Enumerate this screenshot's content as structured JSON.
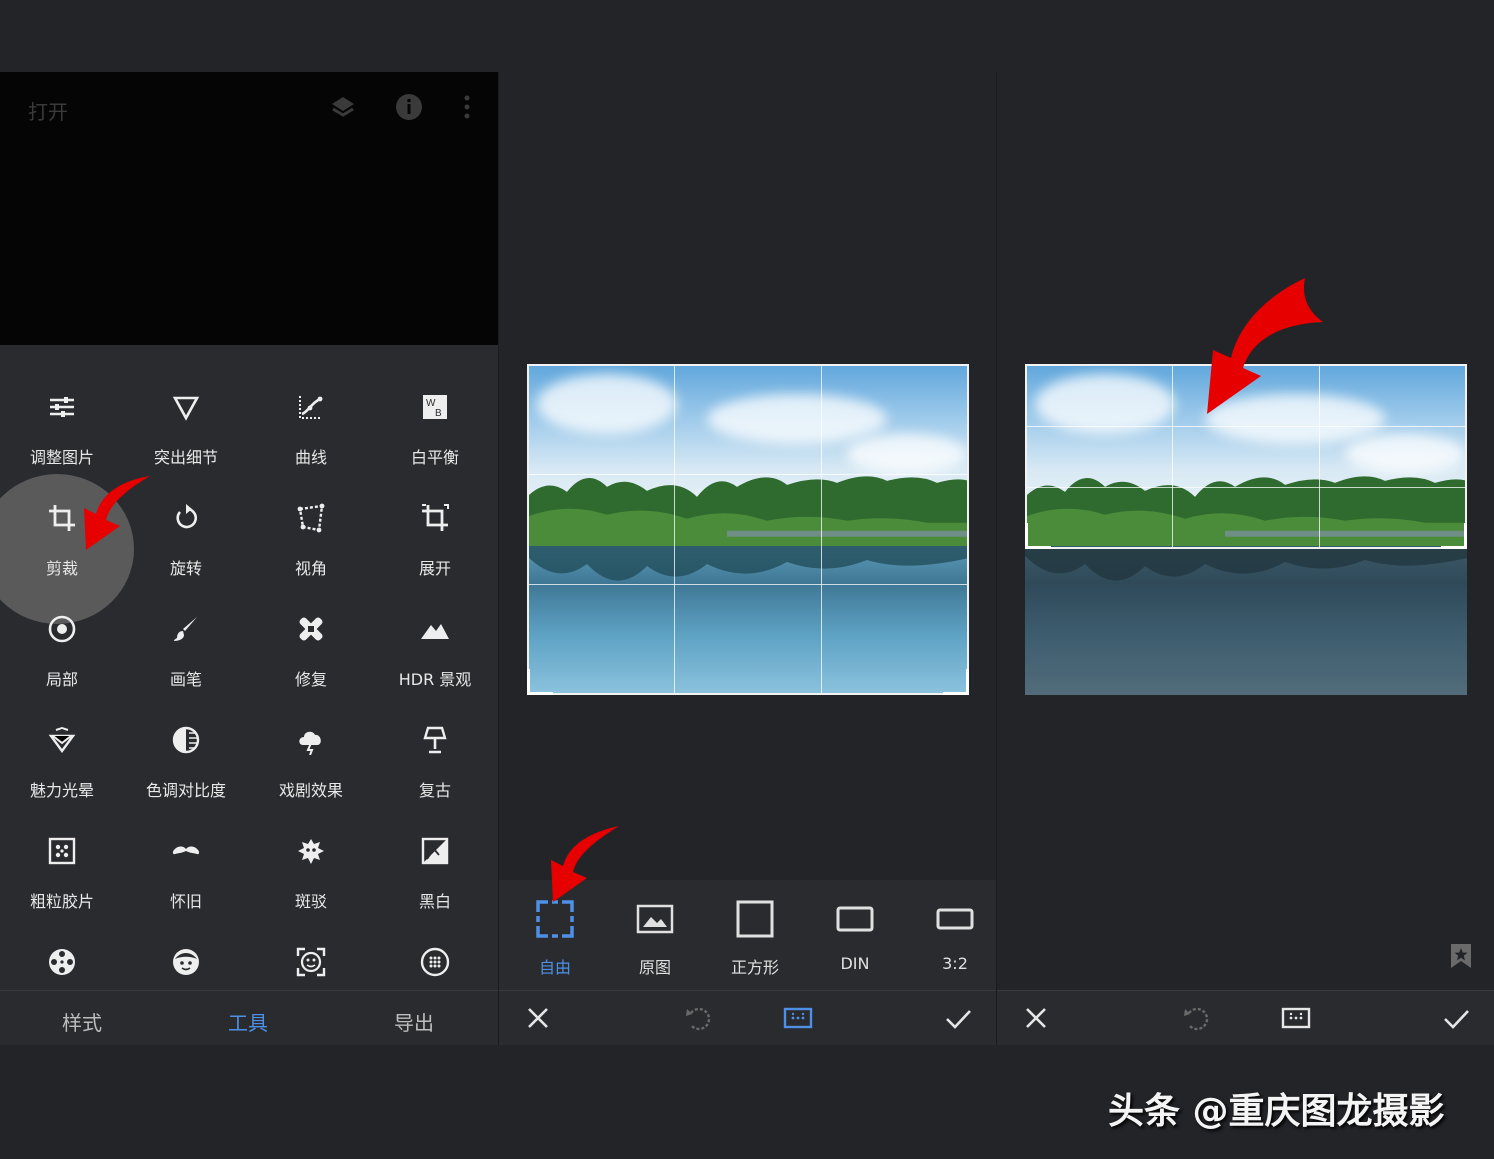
{
  "panel_open": {
    "title": "打开",
    "top_icons": [
      "layers-icon",
      "info-icon",
      "more-vert-icon"
    ],
    "tools": [
      {
        "label": "调整图片",
        "icon": "tune-icon"
      },
      {
        "label": "突出细节",
        "icon": "triangle-down-icon"
      },
      {
        "label": "曲线",
        "icon": "curves-icon"
      },
      {
        "label": "白平衡",
        "icon": "white-balance-icon"
      },
      {
        "label": "剪裁",
        "icon": "crop-icon"
      },
      {
        "label": "旋转",
        "icon": "rotate-icon"
      },
      {
        "label": "视角",
        "icon": "perspective-icon"
      },
      {
        "label": "展开",
        "icon": "expand-crop-icon"
      },
      {
        "label": "局部",
        "icon": "target-icon"
      },
      {
        "label": "画笔",
        "icon": "brush-icon"
      },
      {
        "label": "修复",
        "icon": "bandage-icon"
      },
      {
        "label": "HDR 景观",
        "icon": "mountain-icon"
      },
      {
        "label": "魅力光晕",
        "icon": "diamond-icon"
      },
      {
        "label": "色调对比度",
        "icon": "contrast-icon"
      },
      {
        "label": "戏剧效果",
        "icon": "cloud-lightning-icon"
      },
      {
        "label": "复古",
        "icon": "lamp-icon"
      },
      {
        "label": "粗粒胶片",
        "icon": "grain-icon"
      },
      {
        "label": "怀旧",
        "icon": "mustache-icon"
      },
      {
        "label": "斑驳",
        "icon": "grunge-icon"
      },
      {
        "label": "黑白",
        "icon": "black-white-icon"
      },
      {
        "label": "",
        "icon": "film-reel-icon"
      },
      {
        "label": "",
        "icon": "face-icon"
      },
      {
        "label": "",
        "icon": "face-frame-icon"
      },
      {
        "label": "",
        "icon": "dots-circle-icon"
      }
    ],
    "bottom_tabs": [
      {
        "label": "样式",
        "active": false
      },
      {
        "label": "工具",
        "active": true
      },
      {
        "label": "导出",
        "active": false
      }
    ]
  },
  "panel_crop": {
    "options": [
      {
        "label": "自由",
        "icon": "free-crop-icon",
        "active": true
      },
      {
        "label": "原图",
        "icon": "original-image-icon",
        "active": false
      },
      {
        "label": "正方形",
        "icon": "square-icon",
        "active": false
      },
      {
        "label": "DIN",
        "icon": "din-rect-icon",
        "active": false
      },
      {
        "label": "3:2",
        "icon": "ratio-rect-icon",
        "active": false
      }
    ],
    "actions": [
      "close-icon",
      "rotate-aspect-icon",
      "aspect-options-icon",
      "check-icon"
    ]
  },
  "panel_result": {
    "actions": [
      "close-icon",
      "rotate-aspect-icon",
      "aspect-options-icon",
      "check-icon"
    ],
    "side_icon": "bookmark-star-icon"
  },
  "watermark": "头条 @重庆图龙摄影",
  "colors": {
    "accent": "#4d90e6",
    "arrow": "#e60000",
    "background": "#232428",
    "panel": "#2a2b2f"
  }
}
